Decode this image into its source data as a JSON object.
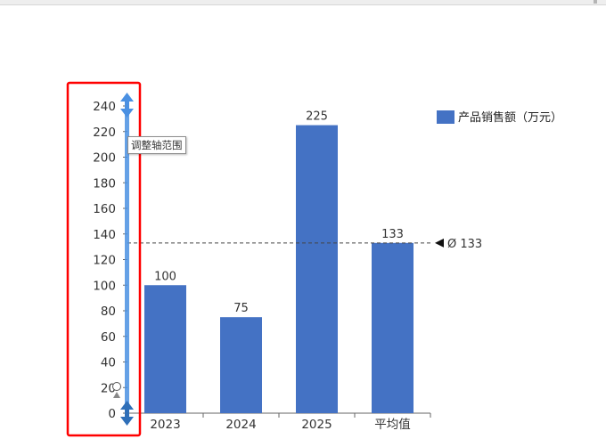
{
  "chart_data": {
    "type": "bar",
    "categories": [
      "2023",
      "2024",
      "2025",
      "平均值"
    ],
    "series": [
      {
        "name": "产品销售额（万元）",
        "values": [
          100,
          75,
          225,
          133
        ]
      }
    ],
    "data_labels": [
      "100",
      "75",
      "225",
      "133"
    ],
    "ylim": [
      0,
      240
    ],
    "y_ticks": [
      0,
      20,
      40,
      60,
      80,
      100,
      120,
      140,
      160,
      180,
      200,
      220,
      240
    ],
    "average_line": {
      "value": 133,
      "label": "Ø 133"
    },
    "legend_position": "top-right",
    "grid": false,
    "colors": {
      "bar": "#4472c4",
      "highlight": "#ff0000",
      "axis_handle": "#4a90e2"
    }
  },
  "axis_tooltip": "调整轴范围"
}
